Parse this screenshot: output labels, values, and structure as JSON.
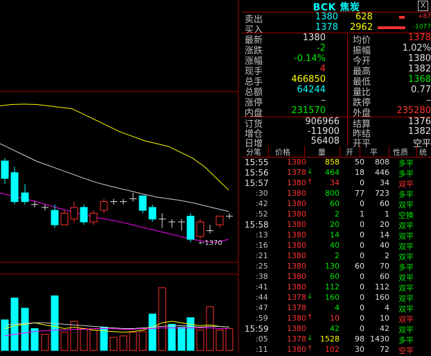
{
  "header": {
    "title": "BCK 焦炭",
    "close_label": "X"
  },
  "colors": {
    "up": "#ff3232",
    "down": "#00e600",
    "cyan": "#00ffff",
    "yellow": "#ffff00",
    "magenta": "#ff00ff",
    "grid": "#a00000"
  },
  "chart": {
    "low_marker": "←1370"
  },
  "quotes": {
    "ask": {
      "label": "卖出",
      "price": "1380",
      "volume": "628",
      "change": "+87"
    },
    "bid": {
      "label": "买入",
      "price": "1378",
      "volume": "2962",
      "change": "-1077"
    }
  },
  "stats": [
    {
      "l1": "最新",
      "v1": "1380",
      "c1": "white",
      "l2": "均价",
      "v2": "1378",
      "c2": "red"
    },
    {
      "l1": "涨跌",
      "v1": "-2",
      "c1": "green",
      "l2": "振幅",
      "v2": "1.02%",
      "c2": "white"
    },
    {
      "l1": "涨幅",
      "v1": "-0.14%",
      "c1": "green",
      "l2": "今开",
      "v2": "1380",
      "c2": "white"
    },
    {
      "l1": "现手",
      "v1": "4",
      "c1": "red",
      "l2": "最高",
      "v2": "1382",
      "c2": "white"
    },
    {
      "l1": "总手",
      "v1": "466850",
      "c1": "yellow",
      "l2": "最低",
      "v2": "1368",
      "c2": "green"
    },
    {
      "l1": "总额",
      "v1": "64244",
      "c1": "cyan",
      "l2": "量比",
      "v2": "0.77",
      "c2": "white"
    },
    {
      "l1": "涨停",
      "v1": "–",
      "c1": "white",
      "l2": "跌停",
      "v2": "–",
      "c2": "white"
    },
    {
      "l1": "内盘",
      "v1": "231570",
      "c1": "green",
      "l2": "外盘",
      "v2": "235280",
      "c2": "red"
    }
  ],
  "stats2": [
    {
      "l1": "订货",
      "v1": "906966",
      "l2": "结算",
      "v2": "1376"
    },
    {
      "l1": "增仓",
      "v1": "-11900",
      "l2": "昨结",
      "v2": "1382"
    },
    {
      "l1": "日增",
      "v1": "56408",
      "l2": "开平",
      "v2": "空平"
    }
  ],
  "table": {
    "headers": [
      "分笔",
      "价格",
      "量",
      "开",
      "平",
      "性质",
      "统"
    ],
    "rows": [
      {
        "time": "15:55",
        "big": true,
        "price": "1380",
        "pc": "red",
        "arrow": "",
        "vol": "858",
        "vc": "yellow",
        "open": "50",
        "close": "808",
        "nature": "多平",
        "nc": "green"
      },
      {
        "time": "15:56",
        "big": true,
        "price": "1378",
        "pc": "red",
        "arrow": "↓",
        "ac": "green",
        "vol": "464",
        "vc": "green",
        "open": "18",
        "close": "446",
        "nature": "多平",
        "nc": "green"
      },
      {
        "time": "15:57",
        "big": true,
        "price": "1380",
        "pc": "red",
        "arrow": "↑",
        "ac": "red",
        "vol": "34",
        "vc": "red",
        "open": "0",
        "close": "34",
        "nature": "双平",
        "nc": "red"
      },
      {
        "time": ":30",
        "big": false,
        "price": "1380",
        "pc": "red",
        "arrow": "",
        "vol": "800",
        "vc": "green",
        "open": "77",
        "close": "723",
        "nature": "多平",
        "nc": "green"
      },
      {
        "time": ":42",
        "big": false,
        "price": "1380",
        "pc": "red",
        "arrow": "",
        "vol": "60",
        "vc": "green",
        "open": "0",
        "close": "60",
        "nature": "双平",
        "nc": "green"
      },
      {
        "time": ":52",
        "big": false,
        "price": "1380",
        "pc": "red",
        "arrow": "",
        "vol": "2",
        "vc": "green",
        "open": "1",
        "close": "1",
        "nature": "空换",
        "nc": "green"
      },
      {
        "time": "15:58",
        "big": true,
        "price": "1380",
        "pc": "red",
        "arrow": "",
        "vol": "20",
        "vc": "green",
        "open": "0",
        "close": "20",
        "nature": "双平",
        "nc": "green"
      },
      {
        "time": ":13",
        "big": false,
        "price": "1380",
        "pc": "red",
        "arrow": "",
        "vol": "14",
        "vc": "green",
        "open": "0",
        "close": "14",
        "nature": "双平",
        "nc": "green"
      },
      {
        "time": ":16",
        "big": false,
        "price": "1380",
        "pc": "red",
        "arrow": "",
        "vol": "40",
        "vc": "green",
        "open": "0",
        "close": "40",
        "nature": "双平",
        "nc": "green"
      },
      {
        "time": ":21",
        "big": false,
        "price": "1380",
        "pc": "red",
        "arrow": "",
        "vol": "2",
        "vc": "green",
        "open": "0",
        "close": "2",
        "nature": "双平",
        "nc": "green"
      },
      {
        "time": ":25",
        "big": false,
        "price": "1380",
        "pc": "red",
        "arrow": "",
        "vol": "130",
        "vc": "green",
        "open": "60",
        "close": "70",
        "nature": "多平",
        "nc": "green"
      },
      {
        "time": ":38",
        "big": false,
        "price": "1380",
        "pc": "red",
        "arrow": "",
        "vol": "60",
        "vc": "green",
        "open": "0",
        "close": "60",
        "nature": "双平",
        "nc": "green"
      },
      {
        "time": ":41",
        "big": false,
        "price": "1380",
        "pc": "red",
        "arrow": "",
        "vol": "112",
        "vc": "green",
        "open": "0",
        "close": "112",
        "nature": "双平",
        "nc": "green"
      },
      {
        "time": ":44",
        "big": false,
        "price": "1378",
        "pc": "red",
        "arrow": "↓",
        "ac": "green",
        "vol": "160",
        "vc": "green",
        "open": "0",
        "close": "160",
        "nature": "双平",
        "nc": "green"
      },
      {
        "time": ":47",
        "big": false,
        "price": "1378",
        "pc": "red",
        "arrow": "",
        "vol": "4",
        "vc": "green",
        "open": "0",
        "close": "4",
        "nature": "双平",
        "nc": "green"
      },
      {
        "time": ":59",
        "big": false,
        "price": "1380",
        "pc": "red",
        "arrow": "↑",
        "ac": "red",
        "vol": "10",
        "vc": "red",
        "open": "0",
        "close": "10",
        "nature": "双平",
        "nc": "red"
      },
      {
        "time": "15:59",
        "big": true,
        "price": "1380",
        "pc": "red",
        "arrow": "",
        "vol": "42",
        "vc": "green",
        "open": "0",
        "close": "42",
        "nature": "双平",
        "nc": "green"
      },
      {
        "time": ":05",
        "big": false,
        "price": "1378",
        "pc": "red",
        "arrow": "↓",
        "ac": "green",
        "vol": "1528",
        "vc": "yellow",
        "open": "98",
        "close": "1430",
        "nature": "多平",
        "nc": "green"
      },
      {
        "time": ":11",
        "big": false,
        "price": "1380",
        "pc": "red",
        "arrow": "↑",
        "ac": "red",
        "vol": "102",
        "vc": "red",
        "open": "30",
        "close": "72",
        "nature": "空平",
        "nc": "red"
      }
    ]
  },
  "chart_data": {
    "type": "candlestick",
    "ylim": [
      1365,
      1420
    ],
    "ma_yellow": [
      1417,
      1417.5,
      1417.6,
      1417.5,
      1417,
      1416.5,
      1416,
      1414,
      1412,
      1410,
      1408,
      1406.5,
      1405,
      1404,
      1403,
      1401,
      1399,
      1396,
      1392,
      1388
    ],
    "ma_white": [
      1404,
      1402,
      1400,
      1398,
      1396.5,
      1395,
      1393.5,
      1392,
      1390.6,
      1389.5,
      1388.5,
      1387.5,
      1386.5,
      1385.6,
      1385,
      1384.4,
      1383.6,
      1382.6,
      1381.6,
      1380.6
    ],
    "ma_magenta": [
      1387,
      1386,
      1385,
      1384,
      1382.8,
      1381.6,
      1380.5,
      1379.5,
      1378.5,
      1377.8,
      1377,
      1376,
      1375,
      1374,
      1373,
      1372,
      1371,
      1370.3,
      1370,
      1371
    ],
    "candles": [
      {
        "x": 7,
        "o": 1398,
        "c": 1392,
        "h": 1399,
        "l": 1390
      },
      {
        "x": 21,
        "o": 1394,
        "c": 1384,
        "h": 1396,
        "l": 1383
      },
      {
        "x": 36,
        "o": 1387,
        "c": 1384,
        "h": 1390,
        "l": 1383
      },
      {
        "x": 50,
        "o": 1383,
        "c": 1383,
        "h": 1384,
        "l": 1382
      },
      {
        "x": 65,
        "o": 1382,
        "c": 1382,
        "h": 1383,
        "l": 1381
      },
      {
        "x": 79,
        "o": 1381,
        "c": 1376,
        "h": 1383,
        "l": 1375
      },
      {
        "x": 93,
        "o": 1376,
        "c": 1380,
        "h": 1381,
        "l": 1376
      },
      {
        "x": 107,
        "o": 1378,
        "c": 1382,
        "h": 1384,
        "l": 1377
      },
      {
        "x": 121,
        "o": 1382,
        "c": 1377,
        "h": 1383,
        "l": 1376
      },
      {
        "x": 135,
        "o": 1377,
        "c": 1380,
        "h": 1381,
        "l": 1376
      },
      {
        "x": 150,
        "o": 1381,
        "c": 1384,
        "h": 1385,
        "l": 1380
      },
      {
        "x": 164,
        "o": 1384,
        "c": 1384,
        "h": 1385,
        "l": 1383
      },
      {
        "x": 178,
        "o": 1384,
        "c": 1384,
        "h": 1385,
        "l": 1383
      },
      {
        "x": 192,
        "o": 1385,
        "c": 1385,
        "h": 1387,
        "l": 1384
      },
      {
        "x": 206,
        "o": 1386,
        "c": 1381,
        "h": 1386,
        "l": 1380
      },
      {
        "x": 220,
        "o": 1382,
        "c": 1378,
        "h": 1383,
        "l": 1377
      },
      {
        "x": 234,
        "o": 1378,
        "c": 1378,
        "h": 1380,
        "l": 1375
      },
      {
        "x": 248,
        "o": 1377,
        "c": 1377,
        "h": 1378,
        "l": 1375
      },
      {
        "x": 262,
        "o": 1377,
        "c": 1377,
        "h": 1378,
        "l": 1374
      },
      {
        "x": 275,
        "o": 1379,
        "c": 1371,
        "h": 1380,
        "l": 1370
      },
      {
        "x": 289,
        "o": 1372,
        "c": 1377,
        "h": 1378,
        "l": 1371
      },
      {
        "x": 303,
        "o": 1374,
        "c": 1374,
        "h": 1376,
        "l": 1373
      },
      {
        "x": 317,
        "o": 1376,
        "c": 1379,
        "h": 1379,
        "l": 1375
      },
      {
        "x": 331,
        "o": 1379,
        "c": 1379,
        "h": 1380,
        "l": 1378
      }
    ],
    "volume_ylim": [
      0,
      100
    ],
    "volumes": [
      {
        "x": 7,
        "v": 42,
        "d": -1
      },
      {
        "x": 21,
        "v": 72,
        "d": -1
      },
      {
        "x": 36,
        "v": 58,
        "d": -1
      },
      {
        "x": 50,
        "v": 30,
        "d": -1
      },
      {
        "x": 65,
        "v": 22,
        "d": 1
      },
      {
        "x": 79,
        "v": 75,
        "d": -1
      },
      {
        "x": 93,
        "v": 25,
        "d": 1
      },
      {
        "x": 107,
        "v": 40,
        "d": 1
      },
      {
        "x": 121,
        "v": 30,
        "d": 1
      },
      {
        "x": 135,
        "v": 28,
        "d": 1
      },
      {
        "x": 150,
        "v": 32,
        "d": -1
      },
      {
        "x": 164,
        "v": 18,
        "d": 1
      },
      {
        "x": 178,
        "v": 20,
        "d": 1
      },
      {
        "x": 192,
        "v": 25,
        "d": 1
      },
      {
        "x": 206,
        "v": 26,
        "d": 1
      },
      {
        "x": 220,
        "v": 50,
        "d": -1
      },
      {
        "x": 234,
        "v": 86,
        "d": 1
      },
      {
        "x": 248,
        "v": 36,
        "d": -1
      },
      {
        "x": 262,
        "v": 32,
        "d": -1
      },
      {
        "x": 275,
        "v": 45,
        "d": -1
      },
      {
        "x": 289,
        "v": 28,
        "d": 1
      },
      {
        "x": 303,
        "v": 60,
        "d": 1
      },
      {
        "x": 317,
        "v": 28,
        "d": 1
      },
      {
        "x": 331,
        "v": 30,
        "d": 1
      }
    ]
  }
}
